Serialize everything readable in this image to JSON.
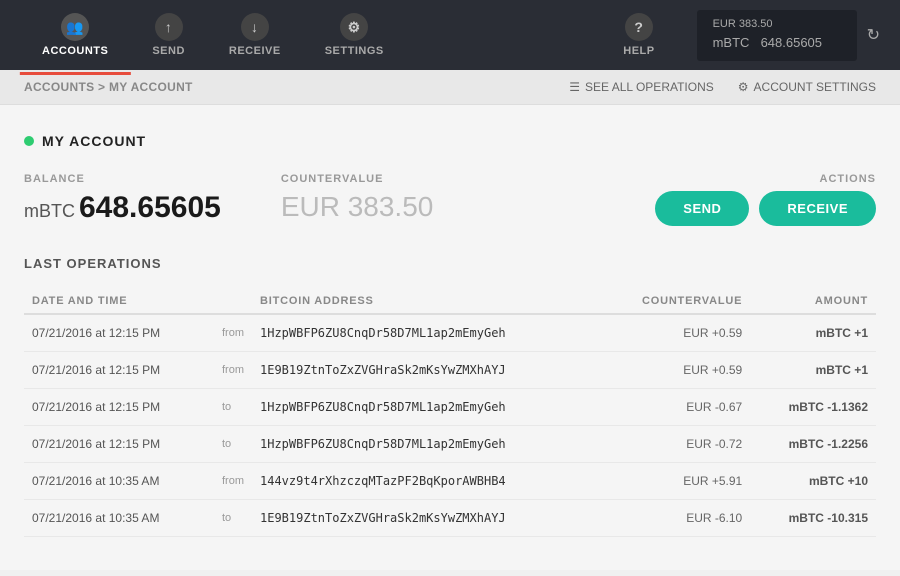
{
  "nav": {
    "items": [
      {
        "id": "accounts",
        "label": "ACCOUNTS",
        "icon": "👥",
        "active": true
      },
      {
        "id": "send",
        "label": "SEND",
        "icon": "↑",
        "active": false
      },
      {
        "id": "receive",
        "label": "RECEIVE",
        "icon": "↓",
        "active": false
      },
      {
        "id": "settings",
        "label": "SETTINGS",
        "icon": "⚙",
        "active": false
      }
    ],
    "help": {
      "label": "HELP",
      "icon": "?"
    },
    "balance": {
      "eur": "EUR 383.50",
      "btc_unit": "mBTC",
      "btc_value": "648.65605"
    }
  },
  "breadcrumb": {
    "root": "ACCOUNTS",
    "separator": ">",
    "current": "MY ACCOUNT",
    "see_all_label": "SEE ALL OPERATIONS",
    "account_settings_label": "ACCOUNT SETTINGS"
  },
  "account": {
    "name": "MY ACCOUNT",
    "balance_label": "BALANCE",
    "balance_unit": "mBTC",
    "balance_value": "648.65605",
    "countervalue_label": "COUNTERVALUE",
    "countervalue_value": "EUR 383.50",
    "actions_label": "ACTIONS",
    "send_btn": "SEND",
    "receive_btn": "RECEIVE"
  },
  "operations": {
    "title": "LAST OPERATIONS",
    "columns": {
      "date": "DATE AND TIME",
      "address": "BITCOIN ADDRESS",
      "countervalue": "COUNTERVALUE",
      "amount": "AMOUNT"
    },
    "rows": [
      {
        "date": "07/21/2016 at 12:15 PM",
        "direction": "from",
        "address": "1HzpWBFP6ZU8CnqDr58D7ML1ap2mEmyGeh",
        "countervalue": "EUR +0.59",
        "amount": "mBTC +1",
        "positive": true
      },
      {
        "date": "07/21/2016 at 12:15 PM",
        "direction": "from",
        "address": "1E9B19ZtnToZxZVGHraSk2mKsYwZMXhAYJ",
        "countervalue": "EUR +0.59",
        "amount": "mBTC +1",
        "positive": true
      },
      {
        "date": "07/21/2016 at 12:15 PM",
        "direction": "to",
        "address": "1HzpWBFP6ZU8CnqDr58D7ML1ap2mEmyGeh",
        "countervalue": "EUR -0.67",
        "amount": "mBTC -1.1362",
        "positive": false
      },
      {
        "date": "07/21/2016 at 12:15 PM",
        "direction": "to",
        "address": "1HzpWBFP6ZU8CnqDr58D7ML1ap2mEmyGeh",
        "countervalue": "EUR -0.72",
        "amount": "mBTC -1.2256",
        "positive": false
      },
      {
        "date": "07/21/2016 at 10:35 AM",
        "direction": "from",
        "address": "144vz9t4rXhzczqMTazPF2BqKporAWBHB4",
        "countervalue": "EUR +5.91",
        "amount": "mBTC +10",
        "positive": true
      },
      {
        "date": "07/21/2016 at 10:35 AM",
        "direction": "to",
        "address": "1E9B19ZtnToZxZVGHraSk2mKsYwZMXhAYJ",
        "countervalue": "EUR -6.10",
        "amount": "mBTC -10.315",
        "positive": false
      }
    ]
  }
}
